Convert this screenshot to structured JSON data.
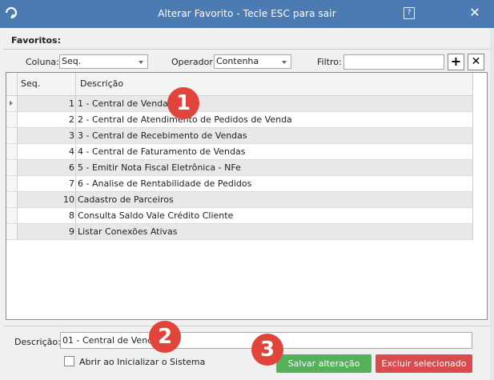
{
  "window": {
    "title": "Alterar Favorito - Tecle ESC para sair",
    "help_glyph": "?",
    "close_glyph": "✕"
  },
  "favoritos": {
    "label": "Favoritos:"
  },
  "filter": {
    "coluna_label": "Coluna:",
    "coluna_value": "Seq.",
    "operador_label": "Operador:",
    "operador_value": "Contenha",
    "filtro_label": "Filtro:",
    "filtro_value": "",
    "add_glyph": "+",
    "remove_glyph": "✕"
  },
  "grid": {
    "columns": [
      "Seq.",
      "Descrição"
    ],
    "rows": [
      {
        "seq": "1",
        "desc": "1 - Central de Vendas"
      },
      {
        "seq": "2",
        "desc": "2 - Central de Atendimento de Pedidos de Venda"
      },
      {
        "seq": "3",
        "desc": "3 - Central de Recebimento de Vendas"
      },
      {
        "seq": "4",
        "desc": "4 - Central de Faturamento de Vendas"
      },
      {
        "seq": "6",
        "desc": "5 - Emitir Nota Fiscal Eletrônica - NFe"
      },
      {
        "seq": "7",
        "desc": "6 - Analise de Rentabilidade de Pedidos"
      },
      {
        "seq": "10",
        "desc": "Cadastro de Parceiros"
      },
      {
        "seq": "8",
        "desc": "Consulta Saldo Vale Crédito Cliente"
      },
      {
        "seq": "9",
        "desc": "Listar Conexões Ativas"
      }
    ]
  },
  "badges": [
    "1",
    "2",
    "3"
  ],
  "form": {
    "descricao_label": "Descrição:",
    "descricao_value": "01 - Central de Vendas",
    "checkbox_label": "Abrir ao Inicializar o Sistema"
  },
  "buttons": {
    "save": "Salvar alteração",
    "delete": "Excluir selecionado"
  },
  "colors": {
    "titlebar": "#4c7ab3",
    "save": "#55b05a",
    "delete": "#dc4b4b",
    "badge": "#e0443a"
  }
}
